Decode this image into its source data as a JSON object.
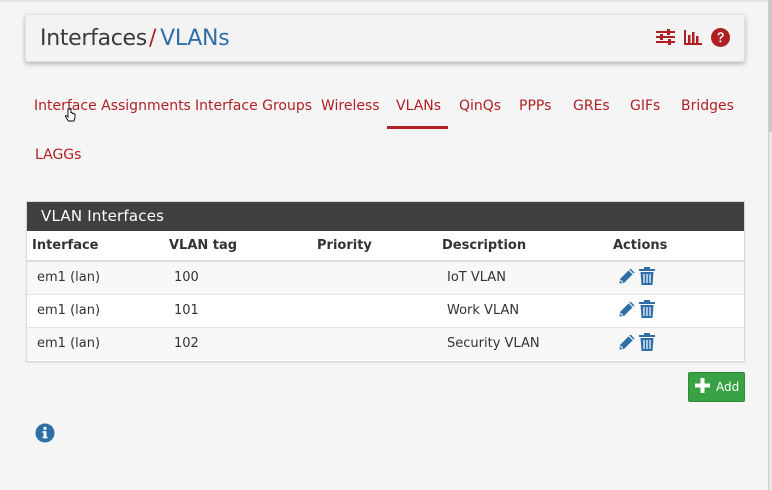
{
  "breadcrumb": {
    "parent": "Interfaces",
    "separator": "/",
    "current": "VLANs"
  },
  "header_icons": [
    {
      "name": "sliders-icon"
    },
    {
      "name": "bar-chart-icon"
    },
    {
      "name": "help-icon"
    }
  ],
  "tabs": [
    {
      "label": "Interface Assignments",
      "active": false
    },
    {
      "label": "Interface Groups",
      "active": false
    },
    {
      "label": "Wireless",
      "active": false
    },
    {
      "label": "VLANs",
      "active": true
    },
    {
      "label": "QinQs",
      "active": false
    },
    {
      "label": "PPPs",
      "active": false
    },
    {
      "label": "GREs",
      "active": false
    },
    {
      "label": "GIFs",
      "active": false
    },
    {
      "label": "Bridges",
      "active": false
    },
    {
      "label": "LAGGs",
      "active": false
    }
  ],
  "panel": {
    "title": "VLAN Interfaces",
    "columns": [
      "Interface",
      "VLAN tag",
      "Priority",
      "Description",
      "Actions"
    ],
    "rows": [
      {
        "interface": "em1 (lan)",
        "vlan_tag": "100",
        "priority": "",
        "description": "IoT VLAN"
      },
      {
        "interface": "em1 (lan)",
        "vlan_tag": "101",
        "priority": "",
        "description": "Work VLAN"
      },
      {
        "interface": "em1 (lan)",
        "vlan_tag": "102",
        "priority": "",
        "description": "Security VLAN"
      }
    ]
  },
  "add_button": {
    "label": "Add"
  },
  "colors": {
    "brand_red": "#b01f24",
    "link_blue": "#2f6fa8",
    "panel_heading": "#404040",
    "add_green": "#39a244"
  }
}
